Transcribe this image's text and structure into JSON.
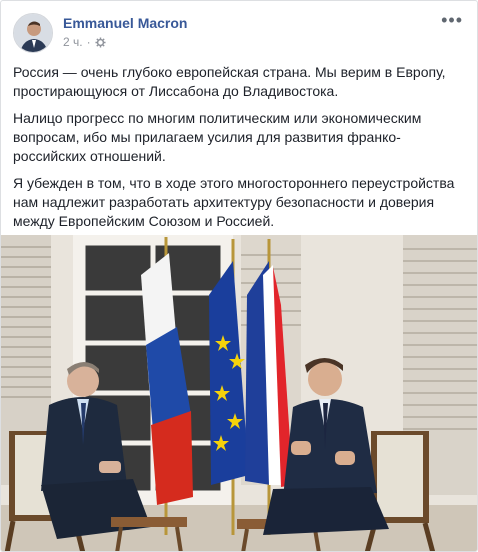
{
  "post": {
    "author": "Emmanuel Macron",
    "time": "2 ч.",
    "separator": "·",
    "privacy_icon": "gear-icon",
    "more_icon": "more-options-icon",
    "more_label": "•••",
    "paragraphs": [
      "Россия — очень глубоко европейская страна. Мы верим в Европу, простирающуюся от Лиссабона до Владивостока.",
      "Налицо прогресс по многим политическим или экономическим вопросам, ибо мы прилагаем усилия для развития франко-российских отношений.",
      "Я убежден в том, что в ходе этого многостороннего переустройства нам надлежит разработать архитектуру безопасности и доверия между Европейским Союзом и Россией."
    ]
  },
  "colors": {
    "link": "#385898",
    "meta": "#90949c",
    "flag_ru_white": "#f4f4f4",
    "flag_ru_blue": "#1f4aa8",
    "flag_ru_red": "#d52b1e",
    "flag_eu_blue": "#1a3e9c",
    "flag_eu_star": "#f5d20a",
    "flag_fr_blue": "#1f3f9a",
    "flag_fr_red": "#e2252b"
  }
}
